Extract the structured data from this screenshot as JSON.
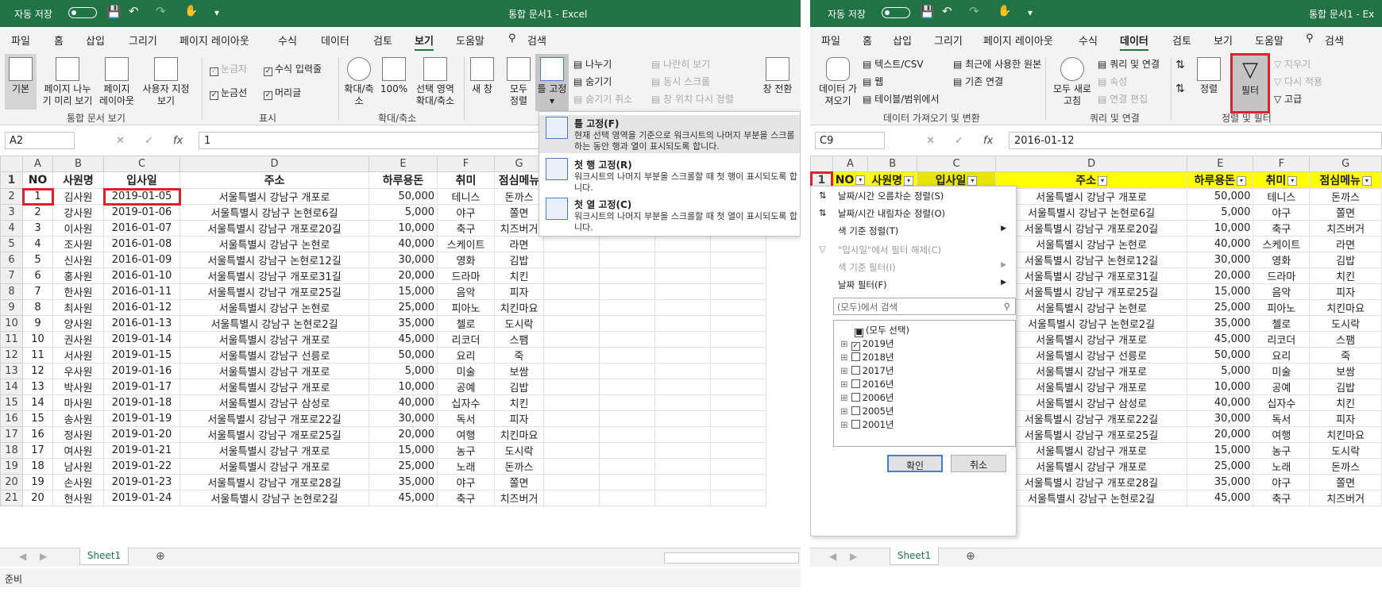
{
  "left": {
    "autosave": "자동 저장",
    "autosave_state": "끔",
    "doc_title": "통합 문서1  -  Excel",
    "tabs": [
      "파일",
      "홈",
      "삽입",
      "그리기",
      "페이지 레이아웃",
      "수식",
      "데이터",
      "검토",
      "보기",
      "도움말"
    ],
    "search": "검색",
    "ribbon": {
      "normal": "기본",
      "pagebreak": "페이지 나누기 미리 보기",
      "pagelayout": "페이지 레이아웃",
      "custom": "사용자 지정 보기",
      "group1": "통합 문서 보기",
      "ruler": "눈금자",
      "formulabar": "수식 입력줄",
      "gridlines": "눈금선",
      "headings": "머리글",
      "group2": "표시",
      "zoom": "확대/축소",
      "zoom100": "100%",
      "zoomsel": "선택 영역 확대/축소",
      "group3": "확대/축소",
      "newwin": "새 창",
      "arrange": "모두 정렬",
      "freeze": "틀 고정",
      "split": "나누기",
      "hide": "숨기기",
      "unhide": "숨기기 취소",
      "sbs": "나란히 보기",
      "sync": "동시 스크롤",
      "reset": "창 위치 다시 정렬",
      "switchwin": "창 전환"
    },
    "namebox": "A2",
    "formula": "1",
    "freeze_menu": [
      {
        "title": "틀 고정(F)",
        "desc": "현재 선택 영역을 기준으로 워크시트의 나머지 부분을 스크롤하는 동안 행과 열이 표시되도록 합니다."
      },
      {
        "title": "첫 행 고정(R)",
        "desc": "워크시트의 나머지 부분을 스크롤할 때 첫 행이 표시되도록 합니다."
      },
      {
        "title": "첫 열 고정(C)",
        "desc": "워크시트의 나머지 부분을 스크롤할 때 첫 열이 표시되도록 합니다."
      }
    ],
    "sheet": "Sheet1",
    "status": "준비"
  },
  "right": {
    "autosave": "자동 저장",
    "autosave_state": "끔",
    "doc_title": "통합 문서1  -  Ex",
    "tabs": [
      "파일",
      "홈",
      "삽입",
      "그리기",
      "페이지 레이아웃",
      "수식",
      "데이터",
      "검토",
      "보기",
      "도움말"
    ],
    "search": "검색",
    "ribbon": {
      "getdata": "데이터 가져오기",
      "textcsv": "텍스트/CSV",
      "web": "웹",
      "table": "테이블/범위에서",
      "recent": "최근에 사용한 원본",
      "existing": "기존 연결",
      "group1": "데이터 가져오기 및 변환",
      "refresh": "모두 새로 고침",
      "queries": "쿼리 및 연결",
      "props": "속성",
      "editlinks": "연결 편집",
      "group2": "쿼리 및 연결",
      "sort": "정렬",
      "filter": "필터",
      "clear": "지우기",
      "reapply": "다시 적용",
      "advanced": "고급",
      "group3": "정렬 및 필터"
    },
    "namebox": "C9",
    "formula": "2016-01-12",
    "filter_menu": {
      "items": [
        "날짜/시간 오름차순 정렬(S)",
        "날짜/시간 내림차순 정렬(O)",
        "색 기준 정렬(T)",
        "\"입사일\"에서 필터 해제(C)",
        "색 기준 필터(I)",
        "날짜 필터(F)"
      ],
      "search_placeholder": "(모두)에서 검색",
      "tree": [
        "(모두 선택)",
        "2019년",
        "2018년",
        "2017년",
        "2016년",
        "2006년",
        "2005년",
        "2001년"
      ],
      "ok": "확인",
      "cancel": "취소"
    },
    "sheet": "Sheet1"
  },
  "cols": [
    "A",
    "B",
    "C",
    "D",
    "E",
    "F",
    "G"
  ],
  "headers": [
    "NO",
    "사원명",
    "입사일",
    "주소",
    "하루용돈",
    "취미",
    "점심메뉴"
  ],
  "rows": [
    [
      "1",
      "김사원",
      "2019-01-05",
      "서울특별시 강남구 개포로",
      "50,000",
      "테니스",
      "돈까스"
    ],
    [
      "2",
      "강사원",
      "2019-01-06",
      "서울특별시 강남구 논현로6길",
      "5,000",
      "야구",
      "쫄면"
    ],
    [
      "3",
      "이사원",
      "2016-01-07",
      "서울특별시 강남구 개포로20길",
      "10,000",
      "축구",
      "치즈버거"
    ],
    [
      "4",
      "조사원",
      "2016-01-08",
      "서울특별시 강남구 논현로",
      "40,000",
      "스케이트",
      "라면"
    ],
    [
      "5",
      "신사원",
      "2016-01-09",
      "서울특별시 강남구 논현로12길",
      "30,000",
      "영화",
      "김밥"
    ],
    [
      "6",
      "홍사원",
      "2016-01-10",
      "서울특별시 강남구 개포로31길",
      "20,000",
      "드라마",
      "치킨"
    ],
    [
      "7",
      "한사원",
      "2016-01-11",
      "서울특별시 강남구 개포로25길",
      "15,000",
      "음악",
      "피자"
    ],
    [
      "8",
      "최사원",
      "2016-01-12",
      "서울특별시 강남구 논현로",
      "25,000",
      "피아노",
      "치킨마요"
    ],
    [
      "9",
      "양사원",
      "2016-01-13",
      "서울특별시 강남구 논현로2길",
      "35,000",
      "첼로",
      "도시락"
    ],
    [
      "10",
      "권사원",
      "2019-01-14",
      "서울특별시 강남구 개포로",
      "45,000",
      "리코더",
      "스팸"
    ],
    [
      "11",
      "서사원",
      "2019-01-15",
      "서울특별시 강남구 선릉로",
      "50,000",
      "요리",
      "죽"
    ],
    [
      "12",
      "우사원",
      "2019-01-16",
      "서울특별시 강남구 개포로",
      "5,000",
      "미술",
      "보쌈"
    ],
    [
      "13",
      "박사원",
      "2019-01-17",
      "서울특별시 강남구 개포로",
      "10,000",
      "공예",
      "김밥"
    ],
    [
      "14",
      "마사원",
      "2019-01-18",
      "서울특별시 강남구 삼성로",
      "40,000",
      "십자수",
      "치킨"
    ],
    [
      "15",
      "송사원",
      "2019-01-19",
      "서울특별시 강남구 개포로22길",
      "30,000",
      "독서",
      "피자"
    ],
    [
      "16",
      "정사원",
      "2019-01-20",
      "서울특별시 강남구 개포로25길",
      "20,000",
      "여행",
      "치킨마요"
    ],
    [
      "17",
      "여사원",
      "2019-01-21",
      "서울특별시 강남구 개포로",
      "15,000",
      "농구",
      "도시락"
    ],
    [
      "18",
      "남사원",
      "2019-01-22",
      "서울특별시 강남구 개포로",
      "25,000",
      "노래",
      "돈까스"
    ],
    [
      "19",
      "손사원",
      "2019-01-23",
      "서울특별시 강남구 개포로28길",
      "35,000",
      "야구",
      "쫄면"
    ],
    [
      "20",
      "현사원",
      "2019-01-24",
      "서울특별시 강남구 논현로2길",
      "45,000",
      "축구",
      "치즈버거"
    ]
  ]
}
